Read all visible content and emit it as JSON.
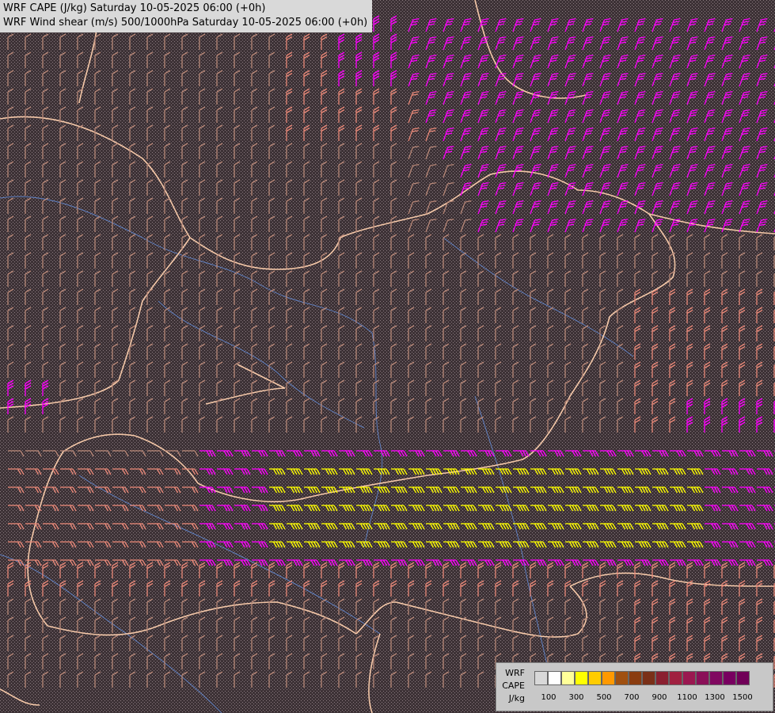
{
  "titles": {
    "line1": "WRF CAPE (J/kg) Saturday 10-05-2025 06:00 (+0h)",
    "line2": "WRF Wind shear (m/s) 500/1000hPa Saturday 10-05-2025 06:00 (+0h)"
  },
  "legend": {
    "name_line1": "WRF",
    "name_line2": "CAPE",
    "unit": "J/kg",
    "tick_labels": [
      "100",
      "300",
      "500",
      "700",
      "900",
      "1100",
      "1300",
      "1500"
    ],
    "colors": [
      "#d8d8d8",
      "#ffffff",
      "#ffff99",
      "#ffff00",
      "#ffcc00",
      "#ff9900",
      "#a05010",
      "#8a3c10",
      "#7a3018",
      "#8a2030",
      "#a02040",
      "#9a1850",
      "#8a1058",
      "#800860",
      "#780060",
      "#700058"
    ]
  },
  "barb_colors": {
    "low": "#b88878",
    "mid": "#e88878",
    "magenta": "#ff00ff",
    "yellow": "#ffff00"
  },
  "map_colors": {
    "background": "#4a3c40",
    "border": "#f5c8a8",
    "river": "#6080c0",
    "relief": "#ffffff"
  }
}
